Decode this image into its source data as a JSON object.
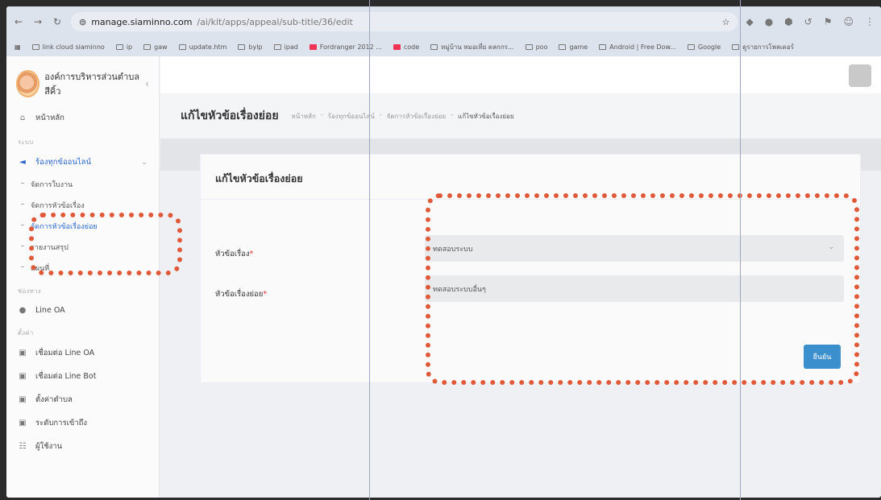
{
  "browser": {
    "host": "manage.siaminno.com",
    "path": "/ai/kit/apps/appeal/sub-title/36/edit"
  },
  "bookmarks": [
    "link cloud siaminno",
    "ip",
    "gaw",
    "update.htm",
    "bylp",
    "ipad",
    "Fordranger 2012 ...",
    "code",
    "หมู่บ้าน หมอเที่ย ตลกกร...",
    "poo",
    "game",
    "Android | Free Dow...",
    "Google",
    "ดูรายการโพลเดอร์"
  ],
  "sidebar": {
    "brand": "องค์การบริหารส่วนตำบล สีคิ้ว",
    "home": "หน้าหลัก",
    "section_main": "ระบบ",
    "menu": "ร้องทุกข์ออนไลน์",
    "sub_items": [
      "จัดการใบงาน",
      "จัดการหัวข้อเรื่อง",
      "จัดการหัวข้อเรื่องย่อย",
      "รายงานสรุป",
      "แผนที่"
    ],
    "section_channel": "ช่องทาง",
    "line_oa": "Line OA",
    "section_settings": "ตั้งค่า",
    "settings_items": [
      "เชื่อมต่อ Line OA",
      "เชื่อมต่อ Line Bot",
      "ตั้งค่าตำบล",
      "ระดับการเข้าถึง",
      "ผู้ใช้งาน"
    ]
  },
  "header": {
    "page_title": "แก้ไขหัวข้อเรื่องย่อย",
    "breadcrumbs": [
      "หน้าหลัก",
      "ร้องทุกข์ออนไลน์",
      "จัดการหัวข้อเรื่องย่อย",
      "แก้ไขหัวข้อเรื่องย่อย"
    ]
  },
  "form": {
    "card_title": "แก้ไขหัวข้อเรื่องย่อย",
    "topic_label": "หัวข้อเรื่อง",
    "topic_value": "ทดสอบระบบ",
    "subtopic_label": "หัวข้อเรื่องย่อย",
    "subtopic_value": "ทดสอบระบบอื่นๆ",
    "required_mark": "*",
    "submit_label": "ยืนยัน"
  },
  "colors": {
    "annotation": "#e05a3a",
    "accent": "#3c8fcd",
    "active_link": "#2a66c8"
  }
}
